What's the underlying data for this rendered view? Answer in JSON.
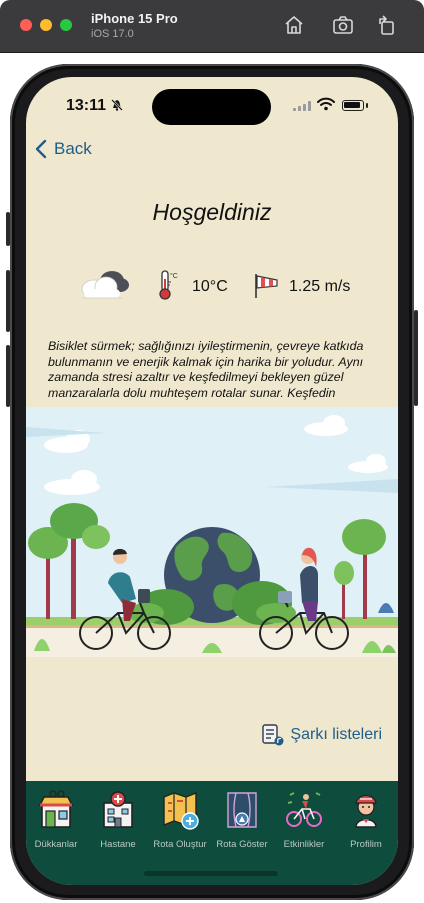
{
  "simulator": {
    "device_name": "iPhone 15 Pro",
    "os_version": "iOS 17.0",
    "icons": [
      "home-icon",
      "screenshot-icon",
      "rotate-icon"
    ]
  },
  "status_bar": {
    "time": "13:11",
    "icons": [
      "bell-slash-icon",
      "signal-icon",
      "wifi-icon",
      "battery-icon"
    ]
  },
  "nav": {
    "back_label": "Back"
  },
  "page": {
    "title": "Hoşgeldiniz"
  },
  "weather": {
    "condition_icon": "partly-cloudy-icon",
    "temperature": "10°C",
    "wind_speed": "1.25 m/s"
  },
  "description": "Bisiklet sürmek; sağlığınızı iyileştirmenin, çevreye katkıda bulunmanın ve enerjik kalmak için harika bir yoludur. Aynı zamanda stresi azaltır ve keşfedilmeyi bekleyen güzel manzaralarla dolu muhteşem rotalar sunar. Keşfedin",
  "illustration": {
    "icon": "cyclists-earth-illustration"
  },
  "playlist": {
    "label": "Şarkı listeleri"
  },
  "tabs": [
    {
      "label": "Dükkanlar",
      "icon": "shop-icon"
    },
    {
      "label": "Hastane",
      "icon": "hospital-icon"
    },
    {
      "label": "Rota Oluştur",
      "icon": "map-add-icon"
    },
    {
      "label": "Rota Göster",
      "icon": "route-icon"
    },
    {
      "label": "Etkinlikler",
      "icon": "cyclist-event-icon"
    },
    {
      "label": "Profilim",
      "icon": "profile-icon"
    }
  ],
  "colors": {
    "background": "#efe8cf",
    "accent": "#1f5d8a",
    "tabbar": "#0e4c3d"
  }
}
